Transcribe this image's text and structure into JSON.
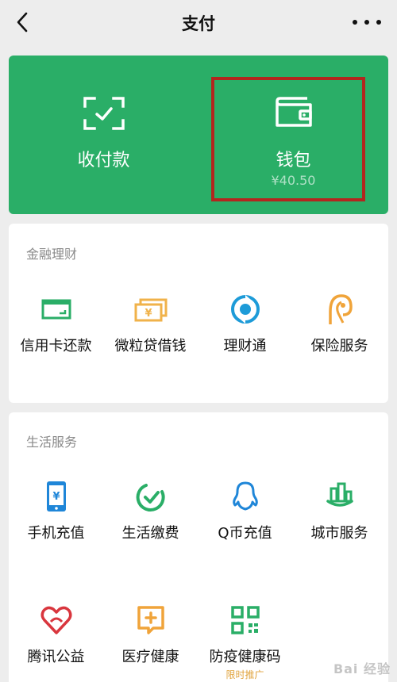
{
  "nav": {
    "title": "支付"
  },
  "hero": {
    "pay_label": "收付款",
    "wallet_label": "钱包",
    "wallet_amount": "¥40.50",
    "brand_color": "#2aae67"
  },
  "finance": {
    "heading": "金融理财",
    "items": [
      {
        "label": "信用卡还款",
        "icon": "credit-card-icon"
      },
      {
        "label": "微粒贷借钱",
        "icon": "loan-icon"
      },
      {
        "label": "理财通",
        "icon": "wealth-icon"
      },
      {
        "label": "保险服务",
        "icon": "insurance-icon"
      }
    ]
  },
  "life": {
    "heading": "生活服务",
    "items": [
      {
        "label": "手机充值",
        "icon": "phone-topup-icon"
      },
      {
        "label": "生活缴费",
        "icon": "utility-bill-icon"
      },
      {
        "label": "Q币充值",
        "icon": "qcoin-icon"
      },
      {
        "label": "城市服务",
        "icon": "city-service-icon"
      },
      {
        "label": "腾讯公益",
        "icon": "charity-icon"
      },
      {
        "label": "医疗健康",
        "icon": "medical-icon"
      },
      {
        "label": "防疫健康码",
        "icon": "health-code-icon",
        "badge": "限时推广"
      }
    ]
  },
  "watermark": "Bai 经验"
}
